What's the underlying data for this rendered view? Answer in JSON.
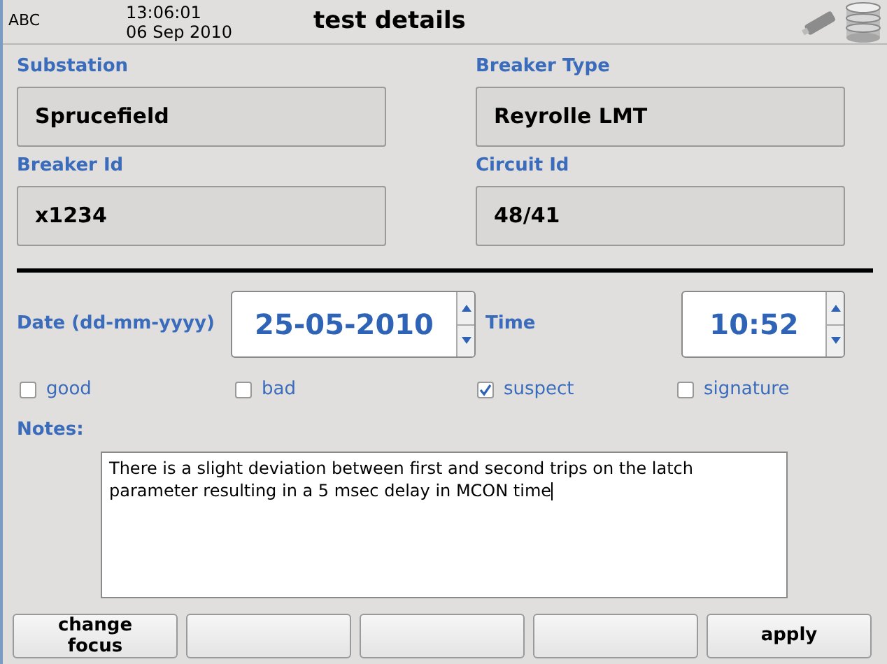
{
  "header": {
    "user": "ABC",
    "time": "13:06:01",
    "date": "06 Sep 2010",
    "title": "test details"
  },
  "fields": [
    {
      "label": "Substation",
      "value": "Sprucefield"
    },
    {
      "label": "Breaker Type",
      "value": "Reyrolle LMT"
    },
    {
      "label": "Breaker Id",
      "value": "x1234"
    },
    {
      "label": "Circuit Id",
      "value": "48/41"
    }
  ],
  "date": {
    "label": "Date (dd-mm-yyyy)",
    "value": "25-05-2010"
  },
  "time": {
    "label": "Time",
    "value": "10:52"
  },
  "checkboxes": [
    {
      "label": "good",
      "checked": false
    },
    {
      "label": "bad",
      "checked": false
    },
    {
      "label": "suspect",
      "checked": true
    },
    {
      "label": "signature",
      "checked": false
    }
  ],
  "notes": {
    "label": "Notes:",
    "value": "There is a slight deviation between first and second trips on the latch parameter resulting in a 5 msec delay in MCON time"
  },
  "buttons": [
    {
      "kind": "labeled",
      "label": "change focus"
    },
    {
      "kind": "blank"
    },
    {
      "kind": "blank"
    },
    {
      "kind": "blank"
    },
    {
      "kind": "labeled",
      "label": "apply"
    }
  ]
}
